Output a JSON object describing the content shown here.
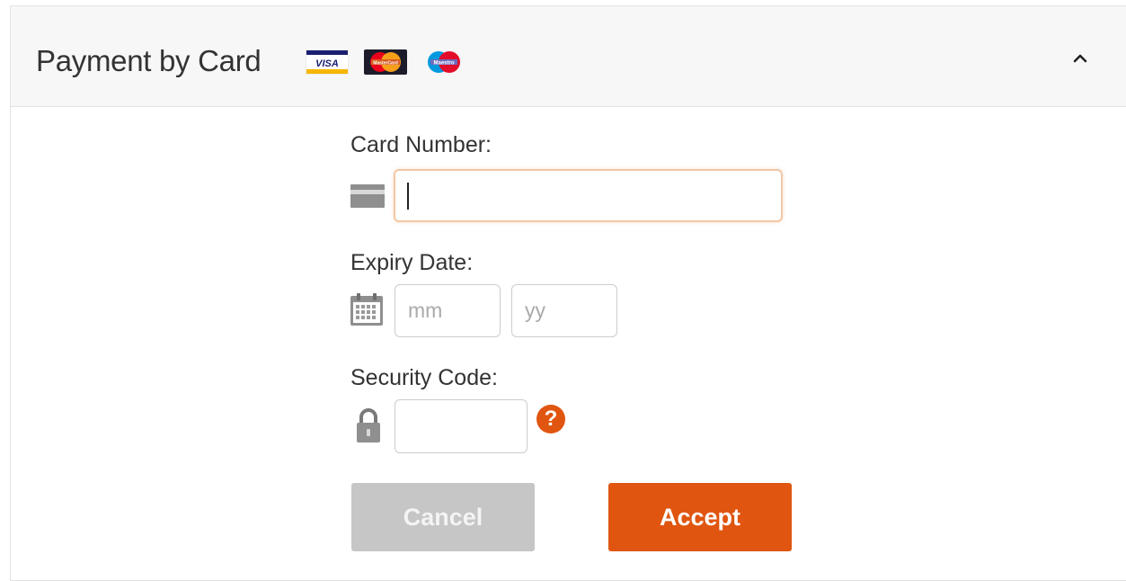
{
  "header": {
    "title": "Payment by Card",
    "card_logos": [
      {
        "name": "visa",
        "text": "VISA"
      },
      {
        "name": "mastercard",
        "text": "MasterCard"
      },
      {
        "name": "maestro",
        "text": "Maestro"
      }
    ],
    "toggle_icon": "chevron-up-icon"
  },
  "form": {
    "card_number": {
      "label": "Card Number:",
      "value": "",
      "placeholder": "",
      "icon": "credit-card-icon"
    },
    "expiry_date": {
      "label": "Expiry Date:",
      "icon": "calendar-icon",
      "month_placeholder": "mm",
      "year_placeholder": "yy",
      "month_value": "",
      "year_value": ""
    },
    "security_code": {
      "label": "Security Code:",
      "value": "",
      "icon": "lock-icon",
      "help": "?"
    }
  },
  "buttons": {
    "cancel": "Cancel",
    "accept": "Accept"
  },
  "colors": {
    "accent": "#e0550f",
    "disabled": "#c6c6c6",
    "header_bg": "#f7f7f7",
    "text": "#333333"
  }
}
